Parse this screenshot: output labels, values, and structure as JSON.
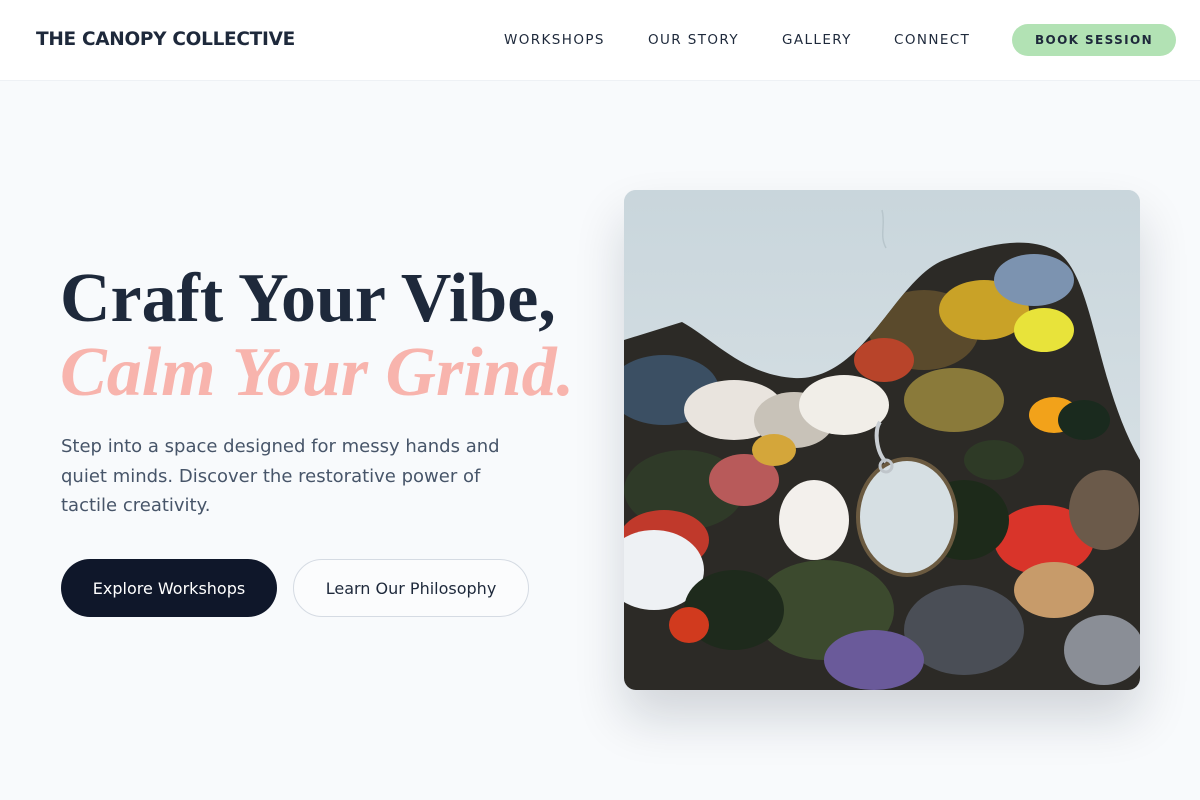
{
  "header": {
    "brand": "THE CANOPY COLLECTIVE",
    "nav": [
      "WORKSHOPS",
      "OUR STORY",
      "GALLERY",
      "CONNECT"
    ],
    "cta": "BOOK SESSION"
  },
  "hero": {
    "headline_line1": "Craft Your Vibe,",
    "headline_line2": "Calm Your Grind.",
    "body": "Step into a space designed for messy hands and quiet minds. Discover the restorative power of tactile creativity.",
    "primary_button": "Explore Workshops",
    "secondary_button": "Learn Our Philosophy"
  },
  "colors": {
    "background": "#f8fafc",
    "heading": "#1e293b",
    "accent_pink": "#f8b4ad",
    "cta_green": "#b2e2b4",
    "primary_button": "#0f172a"
  }
}
